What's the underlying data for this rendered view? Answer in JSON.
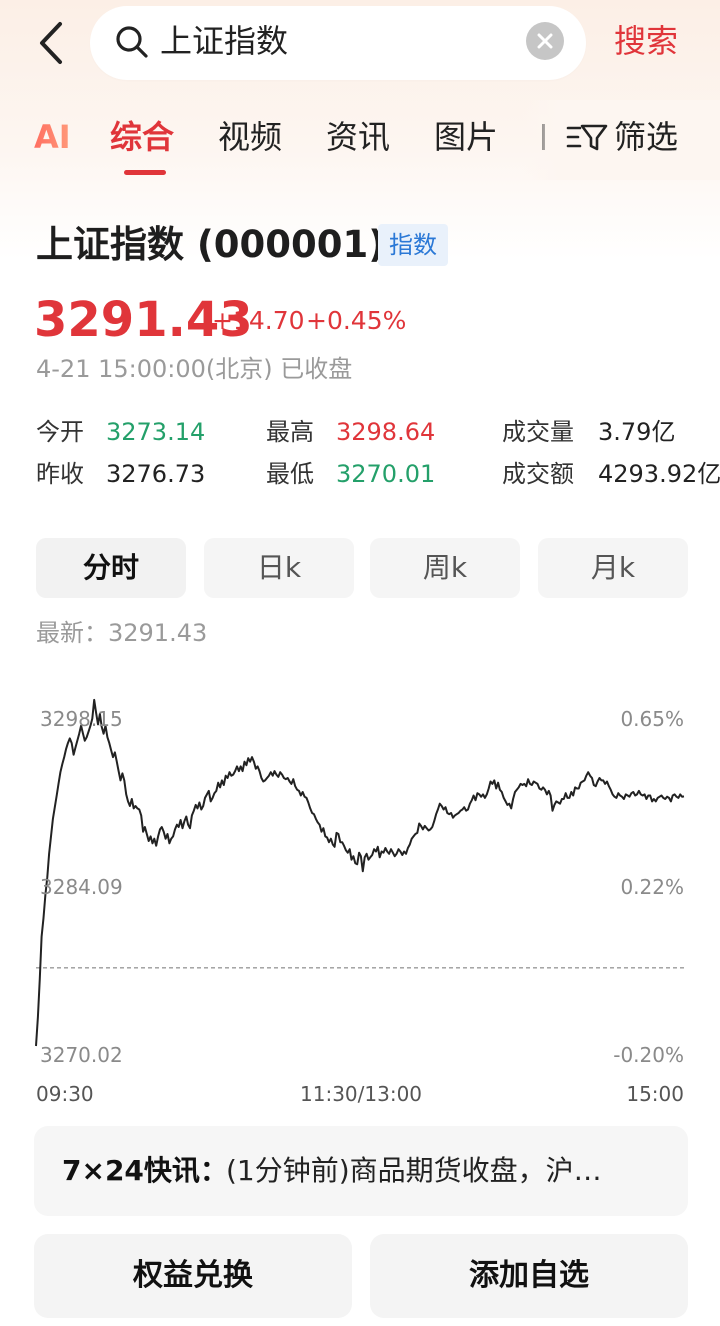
{
  "search": {
    "query": "上证指数",
    "search_button": "搜索"
  },
  "tabs": [
    {
      "label": "AI"
    },
    {
      "label": "综合",
      "active": true
    },
    {
      "label": "视频"
    },
    {
      "label": "资讯"
    },
    {
      "label": "图片"
    }
  ],
  "filter_label": "筛选",
  "stock": {
    "title": "上证指数 (000001)",
    "type_badge": "指数",
    "price": "3291.43",
    "change": "+14.70",
    "change_pct": "+0.45%",
    "timestamp": "4-21 15:00:00(北京) 已收盘",
    "stats": [
      {
        "label": "今开",
        "value": "3273.14",
        "color": "#24a06a"
      },
      {
        "label": "最高",
        "value": "3298.64",
        "color": "#e0353a"
      },
      {
        "label": "成交量",
        "value": "3.79亿",
        "color": "#222222"
      },
      {
        "label": "昨收",
        "value": "3276.73",
        "color": "#222222"
      },
      {
        "label": "最低",
        "value": "3270.01",
        "color": "#24a06a"
      },
      {
        "label": "成交额",
        "value": "4293.92亿",
        "color": "#222222"
      }
    ]
  },
  "periods": [
    {
      "label": "分时",
      "active": true
    },
    {
      "label": "日k"
    },
    {
      "label": "周k"
    },
    {
      "label": "月k"
    }
  ],
  "latest_label": "最新：3291.43",
  "chart_data": {
    "type": "line",
    "y_left_ticks": [
      "3298.15",
      "3284.09",
      "3270.02"
    ],
    "y_right_ticks": [
      "0.65%",
      "0.22%",
      "-0.20%"
    ],
    "x_ticks": [
      "09:30",
      "11:30/13:00",
      "15:00"
    ],
    "ylim": [
      3270.02,
      3298.15
    ],
    "reference_line": 3276.73,
    "line_color": "#222222",
    "series": [
      {
        "values": [
          3270.02,
          3272.5,
          3275.8,
          3279.4,
          3281.0,
          3283.0,
          3284.5,
          3286.5,
          3288.0,
          3289.5,
          3290.5,
          3291.5,
          3292.5,
          3293.5,
          3294.2,
          3294.8,
          3295.5,
          3296.0,
          3296.4,
          3296.0,
          3295.0,
          3295.6,
          3296.2,
          3296.8,
          3297.5,
          3296.8,
          3296.2,
          3296.5,
          3297.0,
          3297.5,
          3298.1,
          3299.7,
          3298.6,
          3297.6,
          3298.5,
          3297.4,
          3296.8,
          3297.5,
          3296.5,
          3296.0,
          3295.4,
          3294.8,
          3295.2,
          3294.4,
          3293.6,
          3292.8,
          3293.4,
          3292.8,
          3291.6,
          3291.0,
          3290.6,
          3291.2,
          3290.4,
          3290.6,
          3290.4,
          3290.3,
          3289.8,
          3288.4,
          3288.8,
          3288.2,
          3287.6,
          3288.0,
          3287.4,
          3287.8,
          3287.2,
          3288.0,
          3288.6,
          3288.8,
          3288.4,
          3287.8,
          3288.2,
          3287.4,
          3287.8,
          3288.0,
          3288.6,
          3289.0,
          3288.8,
          3289.4,
          3288.7,
          3289.3,
          3289.7,
          3289.0,
          3288.7,
          3289.8,
          3290.2,
          3290.7,
          3290.4,
          3290.9,
          3290.3,
          3290.6,
          3291.3,
          3291.6,
          3291.9,
          3291.0,
          3291.3,
          3291.7,
          3291.9,
          3292.6,
          3292.2,
          3292.8,
          3292.4,
          3293.2,
          3293.0,
          3293.5,
          3293.2,
          3293.3,
          3293.6,
          3294.0,
          3293.6,
          3294.0,
          3293.6,
          3294.4,
          3294.1,
          3294.7,
          3294.4,
          3294.8,
          3294.4,
          3293.8,
          3294.0,
          3293.6,
          3293.0,
          3292.7,
          3292.8,
          3293.0,
          3293.2,
          3293.5,
          3293.2,
          3293.6,
          3293.3,
          3293.1,
          3293.5,
          3293.3,
          3293.0,
          3292.9,
          3293.0,
          3292.7,
          3292.5,
          3292.9,
          3292.3,
          3292.0,
          3291.9,
          3291.5,
          3291.8,
          3291.4,
          3291.3,
          3290.9,
          3290.4,
          3290.0,
          3289.9,
          3289.5,
          3289.2,
          3289.0,
          3288.4,
          3288.7,
          3288.0,
          3287.9,
          3287.5,
          3287.8,
          3287.3,
          3287.1,
          3288.3,
          3288.2,
          3287.5,
          3287.5,
          3287.2,
          3286.8,
          3286.6,
          3286.9,
          3286.0,
          3286.3,
          3285.7,
          3285.6,
          3286.6,
          3286.3,
          3285.0,
          3286.2,
          3286.5,
          3286.0,
          3286.2,
          3286.4,
          3286.9,
          3286.7,
          3287.1,
          3286.2,
          3286.7,
          3286.6,
          3287.0,
          3286.7,
          3286.5,
          3286.9,
          3286.6,
          3286.3,
          3286.5,
          3286.9,
          3286.7,
          3286.4,
          3286.7,
          3286.5,
          3287.0,
          3287.3,
          3287.8,
          3288.0,
          3288.2,
          3288.3,
          3289.1,
          3288.9,
          3288.6,
          3288.9,
          3288.7,
          3288.5,
          3288.6,
          3288.8,
          3289.3,
          3289.9,
          3290.3,
          3290.8,
          3290.6,
          3290.3,
          3290.5,
          3290.0,
          3289.9,
          3290.0,
          3289.6,
          3289.8,
          3289.9,
          3290.0,
          3290.2,
          3290.3,
          3290.5,
          3290.2,
          3290.3,
          3290.8,
          3291.1,
          3291.5,
          3291.1,
          3291.7,
          3291.6,
          3291.4,
          3291.6,
          3291.3,
          3291.6,
          3292.1,
          3292.7,
          3292.5,
          3292.8,
          3292.1,
          3292.6,
          3292.0,
          3291.8,
          3291.3,
          3291.0,
          3290.7,
          3290.8,
          3290.4,
          3291.2,
          3291.8,
          3292.0,
          3292.2,
          3292.5,
          3292.4,
          3292.5,
          3292.3,
          3292.9,
          3292.5,
          3292.4,
          3292.7,
          3292.6,
          3292.5,
          3292.1,
          3292.0,
          3292.2,
          3292.0,
          3291.6,
          3291.9,
          3291.5,
          3290.2,
          3290.7,
          3291.0,
          3290.9,
          3290.8,
          3291.2,
          3291.2,
          3291.7,
          3291.3,
          3291.3,
          3291.8,
          3291.5,
          3292.2,
          3292.1,
          3292.1,
          3292.6,
          3292.7,
          3292.8,
          3293.2,
          3293.5,
          3293.2,
          3293.0,
          3292.4,
          3292.3,
          3292.7,
          3293.0,
          3292.8,
          3292.8,
          3292.5,
          3292.7,
          3292.3,
          3292.0,
          3291.6,
          3291.4,
          3291.3,
          3291.7,
          3291.5,
          3291.4,
          3291.2,
          3291.6,
          3291.5,
          3291.4,
          3291.7,
          3291.8,
          3291.5,
          3291.6,
          3291.9,
          3291.6,
          3291.5,
          3291.6,
          3291.2,
          3291.5,
          3291.5,
          3291.0,
          3291.2,
          3291.0,
          3291.3,
          3291.4,
          3291.5,
          3291.3,
          3291.2,
          3291.4,
          3291.3,
          3291.0,
          3291.5,
          3291.6,
          3291.4,
          3291.3,
          3291.6,
          3291.4,
          3291.43
        ]
      }
    ]
  },
  "news": {
    "title": "7×24快讯：",
    "text": "(1分钟前)商品期货收盘，沪…"
  },
  "buttons": {
    "left": "权益兑换",
    "right": "添加自选"
  }
}
